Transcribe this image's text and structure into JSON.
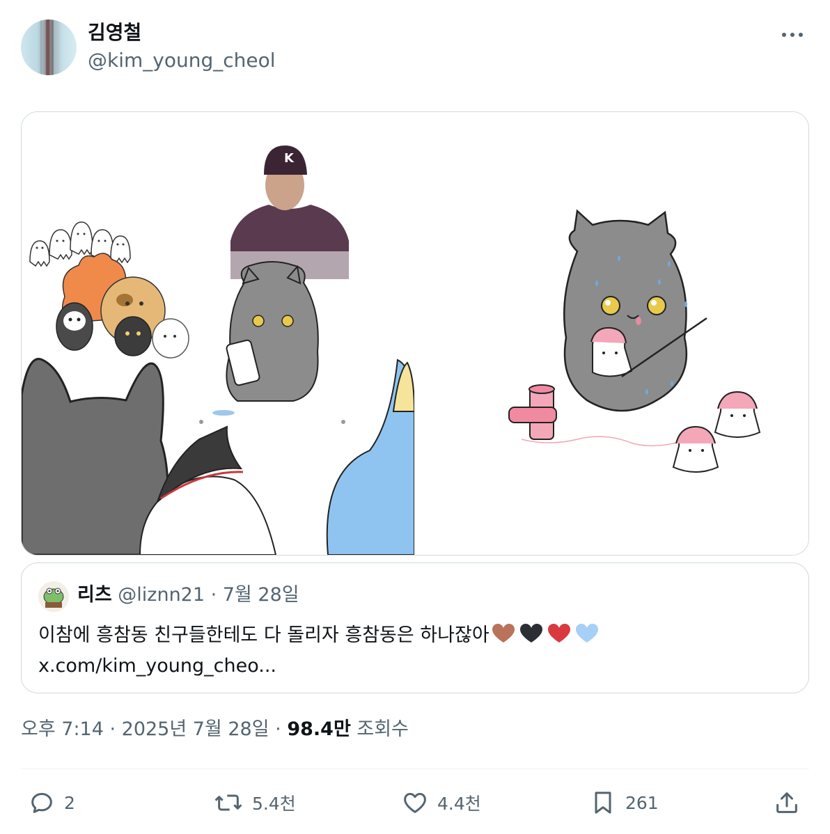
{
  "post": {
    "author": {
      "display_name": "김영철",
      "handle": "@kim_young_cheol"
    },
    "more_icon": "more-horizontal-icon",
    "media": [
      {
        "alt": "illustration-left"
      },
      {
        "alt": "illustration-right"
      }
    ],
    "quote": {
      "display_name": "리츠",
      "handle": "@liznn21",
      "separator": "·",
      "date": "7월 28일",
      "text": "이참에 흥참동 친구들한테도 다 돌리자 흥참동은 하나잖아",
      "link": "x.com/kim_young_cheo...",
      "heart_colors": [
        "#b8735a",
        "#2b2f33",
        "#d93a3f",
        "#a6d0f5"
      ]
    },
    "timestamp": "오후 7:14 · 2025년 7월 28일 · ",
    "views_count": "98.4만",
    "views_label": " 조회수",
    "actions": {
      "reply": {
        "icon": "reply-icon",
        "count": "2"
      },
      "repost": {
        "icon": "repost-icon",
        "count": "5.4천"
      },
      "like": {
        "icon": "heart-icon",
        "count": "4.4천"
      },
      "bookmark": {
        "icon": "bookmark-icon",
        "count": "261"
      },
      "share": {
        "icon": "share-icon"
      }
    }
  }
}
